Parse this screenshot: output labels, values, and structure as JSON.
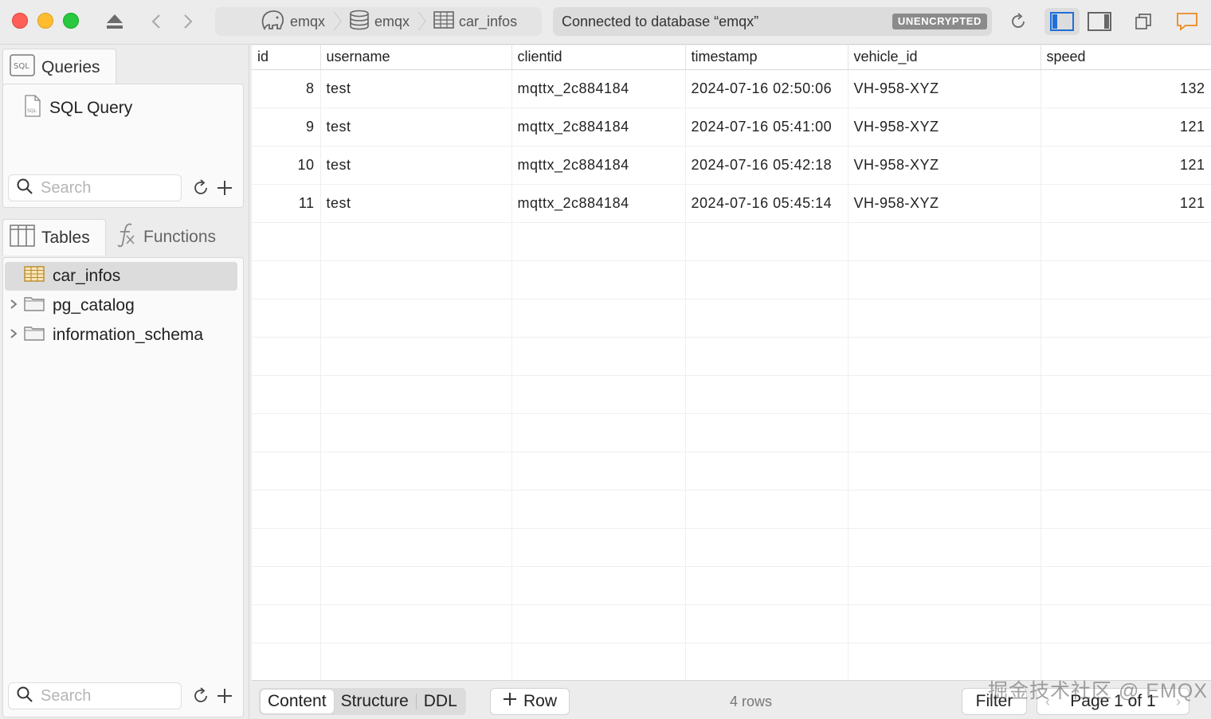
{
  "toolbar": {
    "breadcrumbs": [
      {
        "icon": "postgres-elephant-icon",
        "label": "emqx"
      },
      {
        "icon": "database-icon",
        "label": "emqx"
      },
      {
        "icon": "table-icon",
        "label": "car_infos"
      }
    ],
    "status_text": "Connected to database “emqx”",
    "status_badge": "UNENCRYPTED"
  },
  "sidebar": {
    "queries_tab": "Queries",
    "query_item": "SQL Query",
    "search_placeholder": "Search",
    "tables_tab": "Tables",
    "functions_tab": "Functions",
    "tree": [
      {
        "label": "car_infos",
        "type": "table",
        "selected": true
      },
      {
        "label": "pg_catalog",
        "type": "folder",
        "selected": false
      },
      {
        "label": "information_schema",
        "type": "folder",
        "selected": false
      }
    ],
    "bottom_search_placeholder": "Search"
  },
  "grid": {
    "columns": [
      "id",
      "username",
      "clientid",
      "timestamp",
      "vehicle_id",
      "speed"
    ],
    "rows": [
      [
        "8",
        "test",
        "mqttx_2c884184",
        "2024-07-16 02:50:06",
        "VH-958-XYZ",
        "132"
      ],
      [
        "9",
        "test",
        "mqttx_2c884184",
        "2024-07-16 05:41:00",
        "VH-958-XYZ",
        "121"
      ],
      [
        "10",
        "test",
        "mqttx_2c884184",
        "2024-07-16 05:42:18",
        "VH-958-XYZ",
        "121"
      ],
      [
        "11",
        "test",
        "mqttx_2c884184",
        "2024-07-16 05:45:14",
        "VH-958-XYZ",
        "121"
      ]
    ]
  },
  "bottombar": {
    "tabs": [
      "Content",
      "Structure",
      "DDL"
    ],
    "active_tab": "Content",
    "add_row": "Row",
    "rows_count": "4 rows",
    "filter": "Filter",
    "page": "Page 1 of 1"
  },
  "watermark": "掘金技术社区 @ EMQX"
}
